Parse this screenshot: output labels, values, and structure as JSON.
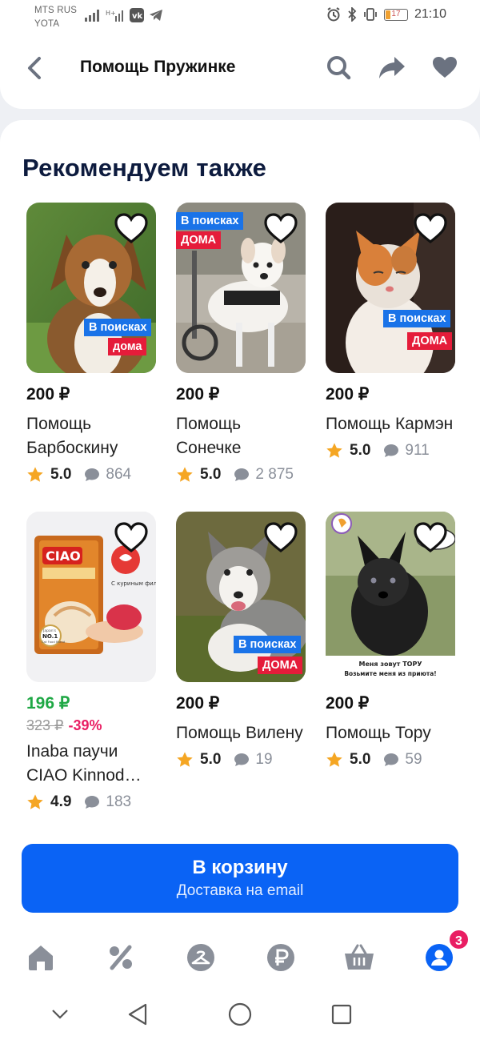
{
  "status_bar": {
    "carrier1": "MTS RUS",
    "carrier2": "YOTA",
    "battery": "17",
    "time": "21:10"
  },
  "header": {
    "title": "Помощь Пружинке",
    "icons": [
      "chevron-left-icon",
      "search-icon",
      "share-icon",
      "heart-icon"
    ]
  },
  "section": {
    "title": "Рекомендуем также"
  },
  "badges": {
    "searching": "В поисках",
    "home": "дома",
    "home_caps": "ДОМА"
  },
  "products": [
    {
      "price": "200 ₽",
      "name": "Помощь Барбоскину",
      "rating": "5.0",
      "comments": "864"
    },
    {
      "price": "200 ₽",
      "name": "Помощь Сонечке",
      "rating": "5.0",
      "comments": "2 875"
    },
    {
      "price": "200 ₽",
      "name": "Помощь Кармэн",
      "rating": "5.0",
      "comments": "911"
    },
    {
      "price": "196 ₽",
      "old_price": "323 ₽",
      "discount": "-39%",
      "name": "Inaba паучи CIAO Kinnod…",
      "rating": "4.9",
      "comments": "183",
      "pack": {
        "brand": "CIAO",
        "note": "С куриным филе",
        "award1": "Japan's",
        "award2": "NO.1",
        "award3": "Cat Food Brand"
      }
    },
    {
      "price": "200 ₽",
      "name": "Помощь Вилену",
      "rating": "5.0",
      "comments": "19"
    },
    {
      "price": "200 ₽",
      "name": "Помощь Тору",
      "rating": "5.0",
      "comments": "59",
      "caption1": "Меня зовут ТОРУ",
      "caption2": "Возьмите меня из приюта!"
    }
  ],
  "cta": {
    "title": "В корзину",
    "subtitle": "Доставка на email"
  },
  "bottom_nav": {
    "items": [
      "home-icon",
      "discount-icon",
      "catalog-icon",
      "ruble-icon",
      "basket-icon",
      "profile-icon"
    ],
    "badge": "3"
  },
  "colors": {
    "accent": "#0a63f5",
    "sale": "#1fa845",
    "discount": "#e91e63",
    "title": "#0d1b3e",
    "badge_blue": "#1a73e8",
    "badge_red": "#e51c3a"
  }
}
